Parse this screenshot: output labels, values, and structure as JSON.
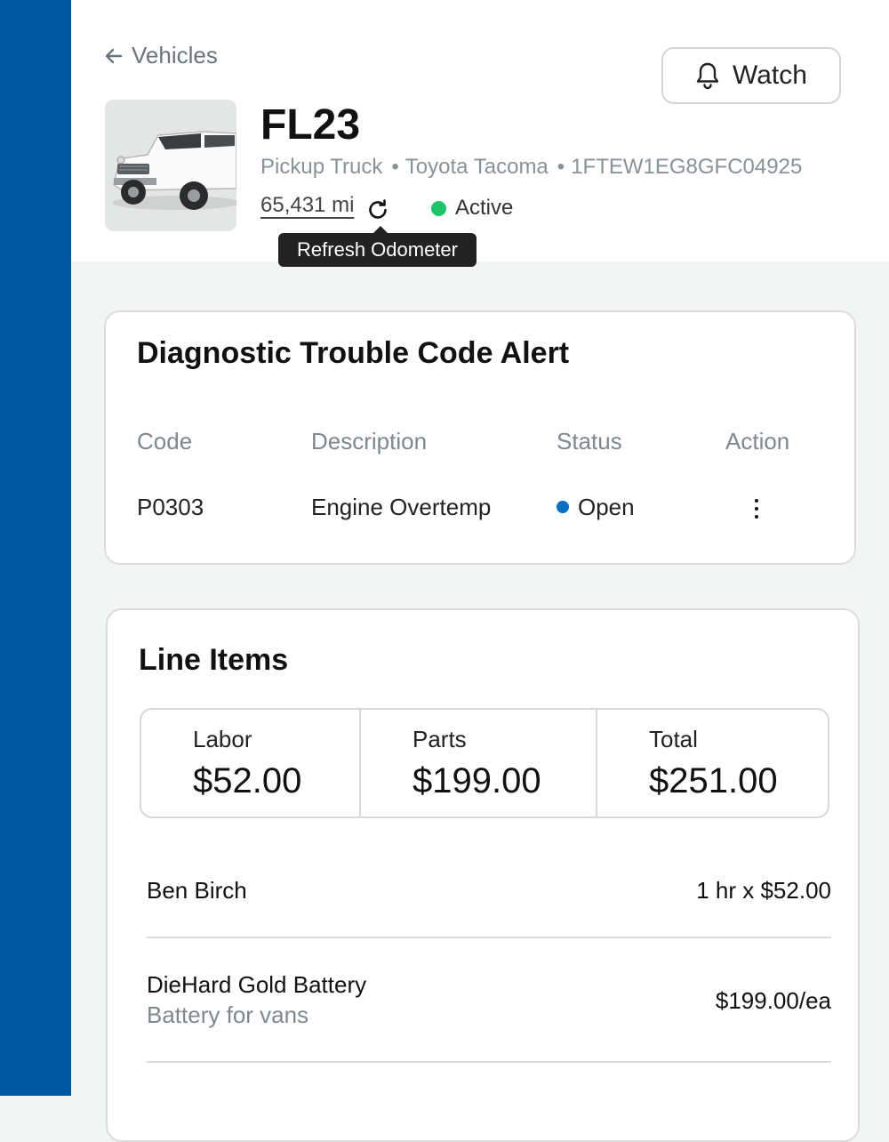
{
  "header": {
    "back_label": "Vehicles",
    "watch_label": "Watch",
    "vehicle_name": "FL23",
    "vehicle_type": "Pickup Truck",
    "vehicle_model": "Toyota Tacoma",
    "vin": "1FTEW1EG8GFC04925",
    "separator": "•",
    "odometer": "65,431 mi",
    "status": "Active",
    "tooltip": "Refresh Odometer"
  },
  "dtc": {
    "title": "Diagnostic Trouble Code Alert",
    "columns": [
      "Code",
      "Description",
      "Status",
      "Action"
    ],
    "rows": [
      {
        "code": "P0303",
        "description": "Engine Overtemp",
        "status": "Open"
      }
    ]
  },
  "line_items": {
    "title": "Line Items",
    "summary": [
      {
        "label": "Labor",
        "value": "$52.00"
      },
      {
        "label": "Parts",
        "value": "$199.00"
      },
      {
        "label": "Total",
        "value": "$251.00"
      }
    ],
    "items": [
      {
        "name": "Ben Birch",
        "price": "1 hr x $52.00"
      },
      {
        "name": "DieHard Gold Battery",
        "subtitle": "Battery for vans",
        "price": "$199.00/ea"
      }
    ]
  },
  "colors": {
    "sidebar": "#0157a0",
    "status_active": "#1ec46a",
    "status_open": "#0a6fc2"
  }
}
